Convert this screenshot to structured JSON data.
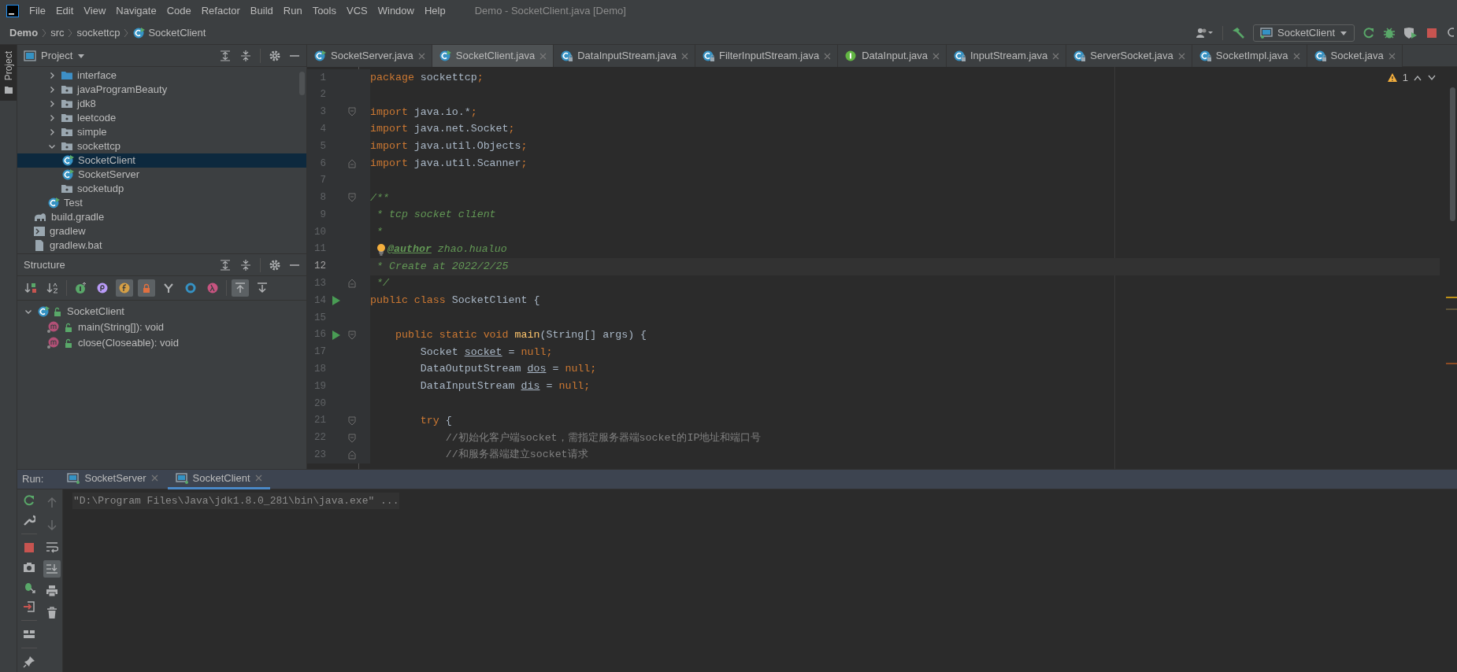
{
  "window": {
    "title": "Demo - SocketClient.java [Demo]"
  },
  "menu": [
    "File",
    "Edit",
    "View",
    "Navigate",
    "Code",
    "Refactor",
    "Build",
    "Run",
    "Tools",
    "VCS",
    "Window",
    "Help"
  ],
  "breadcrumbs": [
    {
      "label": "Demo",
      "kind": "project"
    },
    {
      "label": "src",
      "kind": "folder"
    },
    {
      "label": "sockettcp",
      "kind": "folder"
    },
    {
      "label": "SocketClient",
      "kind": "class"
    }
  ],
  "toolbar": {
    "run_config": "SocketClient"
  },
  "side_tabs": [
    {
      "label": "Project",
      "selected": true
    }
  ],
  "project": {
    "title": "Project",
    "tree": [
      {
        "children": [
          {
            "label": "interface",
            "kind": "module",
            "expanded": false
          },
          {
            "label": "javaProgramBeauty",
            "kind": "package",
            "expanded": false
          },
          {
            "label": "jdk8",
            "kind": "package",
            "expanded": false
          },
          {
            "label": "leetcode",
            "kind": "package",
            "expanded": false
          },
          {
            "label": "simple",
            "kind": "package",
            "expanded": false
          },
          {
            "label": "sockettcp",
            "kind": "package",
            "expanded": true,
            "children": [
              {
                "label": "SocketClient",
                "kind": "runnable",
                "selected": true
              },
              {
                "label": "SocketServer",
                "kind": "runnable",
                "selected": false
              }
            ]
          },
          {
            "label": "socketudp",
            "kind": "package"
          },
          {
            "label": "Test",
            "kind": "runnable",
            "selected": false
          }
        ]
      },
      {
        "label": "build.gradle",
        "kind": "gradle",
        "selected": false
      },
      {
        "label": "gradlew",
        "kind": "script",
        "selected": false
      },
      {
        "label": "gradlew.bat",
        "kind": "bat",
        "selected": false
      }
    ]
  },
  "structure": {
    "title": "Structure",
    "toggles": [
      {
        "on": false
      },
      {
        "on": false
      },
      {
        "on": false
      },
      {
        "on": false
      },
      {
        "on": true
      },
      {
        "on": true
      },
      {
        "on": false
      },
      {
        "on": false
      },
      {
        "on": false
      },
      {
        "on": true
      },
      {
        "on": false
      }
    ],
    "tree": [
      {
        "label": "SocketClient",
        "kind": "class",
        "expanded": true,
        "children": [
          {
            "label": "main(String[]): void",
            "kind": "method"
          },
          {
            "label": "close(Closeable): void",
            "kind": "method"
          }
        ]
      }
    ]
  },
  "editor": {
    "tabs": [
      {
        "label": "SocketServer.java",
        "kind": "runnable",
        "selected": false
      },
      {
        "label": "SocketClient.java",
        "kind": "runnable",
        "selected": true
      },
      {
        "label": "DataInputStream.java",
        "kind": "locked",
        "selected": false
      },
      {
        "label": "FilterInputStream.java",
        "kind": "locked",
        "selected": false
      },
      {
        "label": "DataInput.java",
        "kind": "interface",
        "selected": false
      },
      {
        "label": "InputStream.java",
        "kind": "locked",
        "selected": false
      },
      {
        "label": "ServerSocket.java",
        "kind": "locked",
        "selected": false
      },
      {
        "label": "SocketImpl.java",
        "kind": "locked",
        "selected": false
      },
      {
        "label": "Socket.java",
        "kind": "locked",
        "selected": false
      }
    ],
    "warnings": "1",
    "lines": [
      {
        "number": "1",
        "current": false,
        "tokens": [
          {
            "kind": "kw",
            "text": "package"
          },
          {
            "kind": "plain",
            "text": " sockettcp"
          },
          {
            "kind": "kw",
            "text": ";"
          }
        ]
      },
      {
        "number": "2",
        "current": false
      },
      {
        "number": "3",
        "current": false,
        "gutter": [
          {
            "kind": "fold-start"
          }
        ],
        "tokens": [
          {
            "kind": "kw",
            "text": "import"
          },
          {
            "kind": "plain",
            "text": " java.io.*"
          },
          {
            "kind": "kw",
            "text": ";"
          }
        ]
      },
      {
        "number": "4",
        "current": false,
        "tokens": [
          {
            "kind": "kw",
            "text": "import"
          },
          {
            "kind": "plain",
            "text": " java.net.Socket"
          },
          {
            "kind": "kw",
            "text": ";"
          }
        ]
      },
      {
        "number": "5",
        "current": false,
        "tokens": [
          {
            "kind": "kw",
            "text": "import"
          },
          {
            "kind": "plain",
            "text": " java.util.Objects"
          },
          {
            "kind": "kw",
            "text": ";"
          }
        ]
      },
      {
        "number": "6",
        "current": false,
        "gutter": [
          {
            "kind": "fold-end"
          }
        ],
        "tokens": [
          {
            "kind": "kw",
            "text": "import"
          },
          {
            "kind": "plain",
            "text": " java.util.Scanner"
          },
          {
            "kind": "kw",
            "text": ";"
          }
        ]
      },
      {
        "number": "7",
        "current": false
      },
      {
        "number": "8",
        "current": false,
        "gutter": [
          {
            "kind": "fold-start"
          }
        ],
        "tokens": [
          {
            "kind": "doc",
            "text": "/**"
          }
        ]
      },
      {
        "number": "9",
        "current": false,
        "tokens": [
          {
            "kind": "doc",
            "text": " * tcp socket client"
          }
        ]
      },
      {
        "number": "10",
        "current": false,
        "tokens": [
          {
            "kind": "doc",
            "text": " *"
          }
        ]
      },
      {
        "number": "11",
        "current": false,
        "gutter": [
          {
            "kind": "bulb"
          }
        ],
        "tokens": [
          {
            "kind": "doctag",
            "text": "@author"
          },
          {
            "kind": "doc",
            "text": " zhao.hualuo"
          }
        ]
      },
      {
        "number": "12",
        "current": true,
        "tokens": [
          {
            "kind": "doc",
            "text": " * Create at 2022/2/25"
          }
        ]
      },
      {
        "number": "13",
        "current": false,
        "gutter": [
          {
            "kind": "fold-end"
          }
        ],
        "tokens": [
          {
            "kind": "doc",
            "text": " */"
          }
        ]
      },
      {
        "number": "14",
        "current": false,
        "gutter": [
          {
            "kind": "run"
          }
        ],
        "tokens": [
          {
            "kind": "kw",
            "text": "public class "
          },
          {
            "kind": "plain",
            "text": "SocketClient {"
          }
        ]
      },
      {
        "number": "15",
        "current": false
      },
      {
        "number": "16",
        "current": false,
        "gutter": [
          {
            "kind": "run"
          },
          {
            "kind": "fold-start"
          }
        ],
        "tokens": [
          {
            "kind": "kw",
            "text": "    public static void "
          },
          {
            "kind": "method",
            "text": "main"
          },
          {
            "kind": "plain",
            "text": "(String[] args) {"
          }
        ]
      },
      {
        "number": "17",
        "current": false,
        "tokens": [
          {
            "kind": "plain",
            "text": "        Socket "
          },
          {
            "kind": "var",
            "text": "socket"
          },
          {
            "kind": "plain",
            "text": " = "
          },
          {
            "kind": "kw",
            "text": "null;"
          }
        ]
      },
      {
        "number": "18",
        "current": false,
        "tokens": [
          {
            "kind": "plain",
            "text": "        DataOutputStream "
          },
          {
            "kind": "var",
            "text": "dos"
          },
          {
            "kind": "plain",
            "text": " = "
          },
          {
            "kind": "kw",
            "text": "null;"
          }
        ]
      },
      {
        "number": "19",
        "current": false,
        "tokens": [
          {
            "kind": "plain",
            "text": "        DataInputStream "
          },
          {
            "kind": "var",
            "text": "dis"
          },
          {
            "kind": "plain",
            "text": " = "
          },
          {
            "kind": "kw",
            "text": "null;"
          }
        ]
      },
      {
        "number": "20",
        "current": false
      },
      {
        "number": "21",
        "current": false,
        "gutter": [
          {
            "kind": "fold-start"
          }
        ],
        "tokens": [
          {
            "kind": "kw",
            "text": "        try"
          },
          {
            "kind": "plain",
            "text": " {"
          }
        ]
      },
      {
        "number": "22",
        "current": false,
        "gutter": [
          {
            "kind": "fold-start"
          }
        ],
        "tokens": [
          {
            "kind": "comment",
            "text": "            //初始化客户端socket，需指定服务器端socket的IP地址和端口号"
          }
        ]
      },
      {
        "number": "23",
        "current": false,
        "gutter": [
          {
            "kind": "fold-end"
          }
        ],
        "tokens": [
          {
            "kind": "comment",
            "text": "            //和服务器端建立socket请求"
          }
        ]
      }
    ]
  },
  "run": {
    "label": "Run:",
    "tabs": [
      {
        "label": "SocketServer",
        "selected": false
      },
      {
        "label": "SocketClient",
        "selected": true
      }
    ],
    "console": [
      "\"D:\\Program Files\\Java\\jdk1.8.0_281\\bin\\java.exe\" ..."
    ],
    "side_tools": [
      {
        "disabled": true,
        "on": false
      },
      {
        "disabled": true,
        "on": false
      },
      {
        "disabled": false,
        "on": false
      },
      {
        "disabled": false,
        "on": true
      },
      {
        "disabled": false,
        "on": false
      },
      {
        "disabled": false,
        "on": false
      }
    ]
  }
}
